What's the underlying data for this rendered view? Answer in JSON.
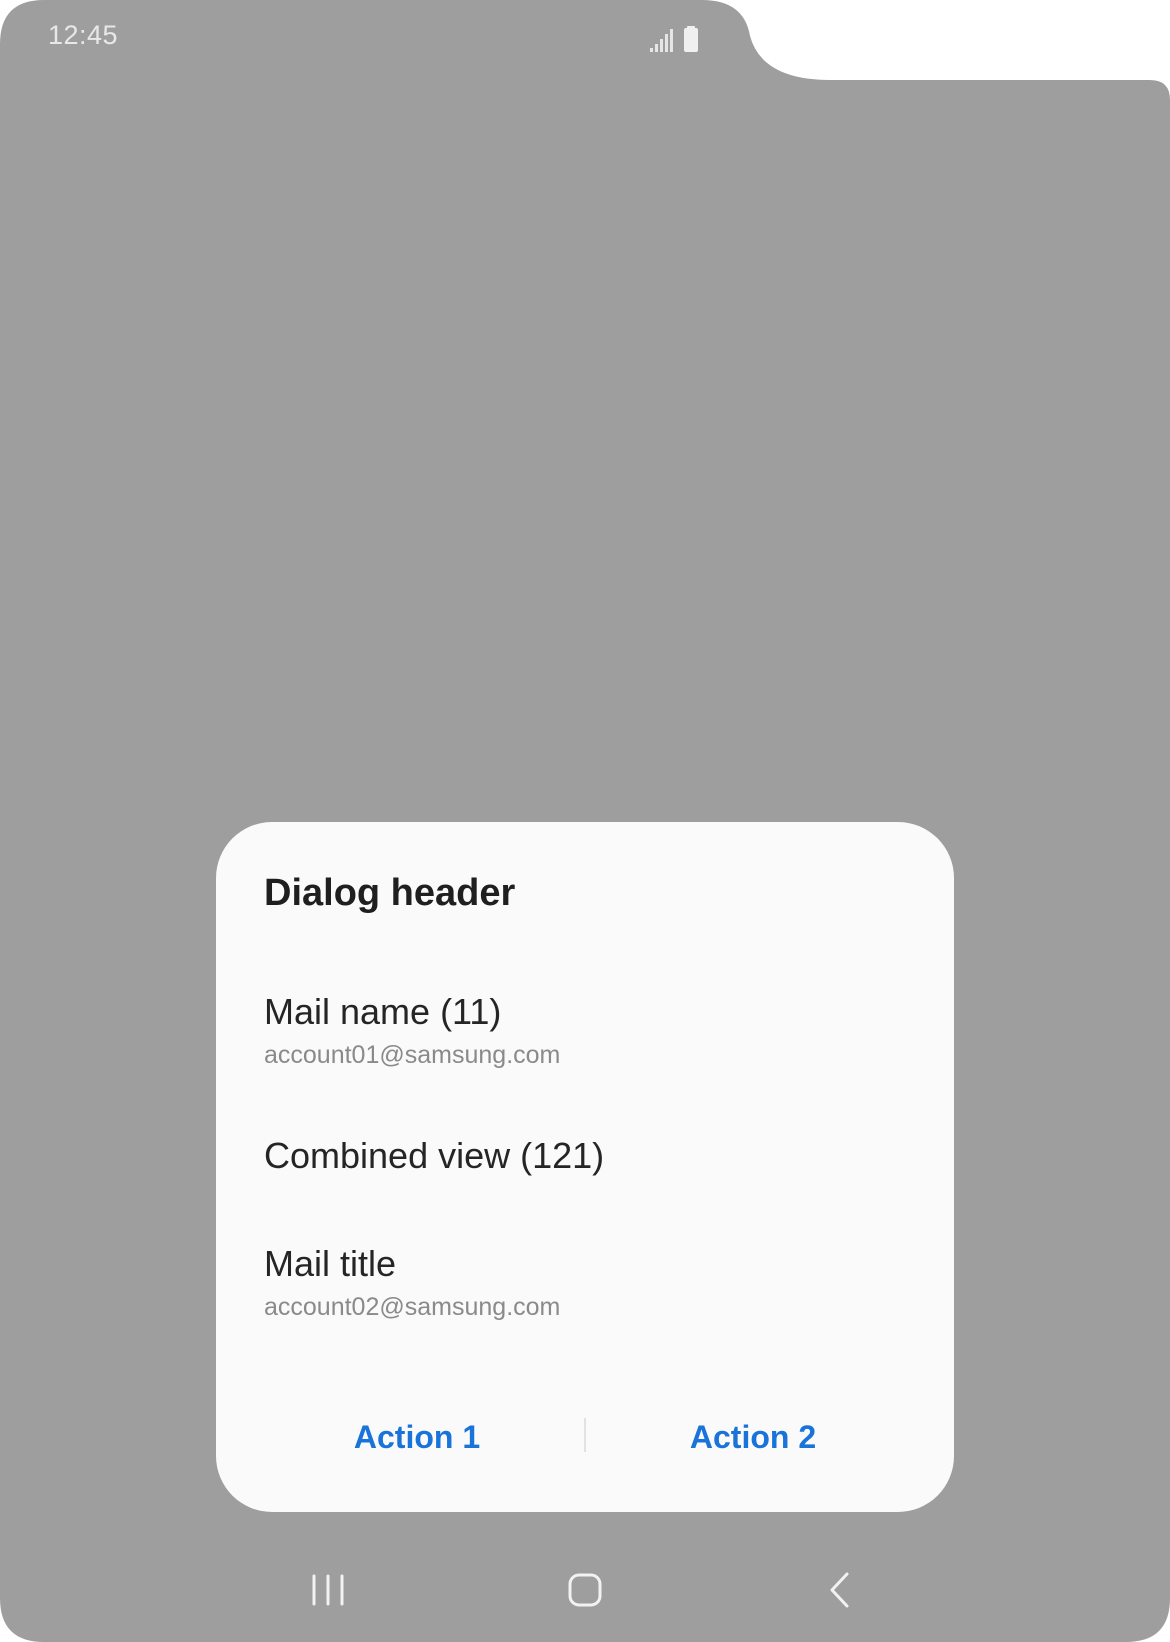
{
  "colors": {
    "scrim": "#9e9e9e",
    "dialog_bg": "#fafafa",
    "action_text": "#1a73d8",
    "primary_text": "#252525",
    "secondary_text": "#8a8a8a"
  },
  "status_bar": {
    "time": "12:45",
    "icons": [
      "signal-icon",
      "battery-icon"
    ]
  },
  "dialog": {
    "title": "Dialog header",
    "items": [
      {
        "primary": "Mail name (11)",
        "secondary": "account01@samsung.com"
      },
      {
        "primary": "Combined view (121)",
        "secondary": ""
      },
      {
        "primary": "Mail title",
        "secondary": "account02@samsung.com"
      }
    ],
    "actions": [
      {
        "label": "Action 1"
      },
      {
        "label": "Action 2"
      }
    ]
  },
  "nav_bar": {
    "buttons": [
      "recents-icon",
      "home-icon",
      "back-icon"
    ]
  }
}
